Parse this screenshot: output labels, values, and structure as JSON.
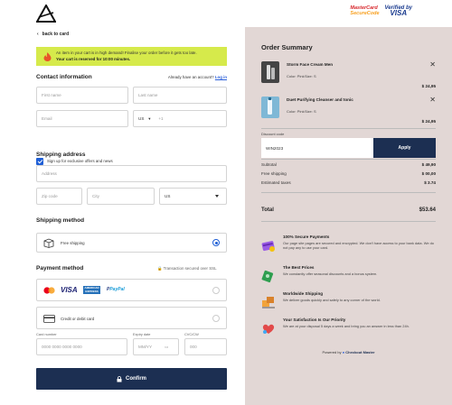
{
  "header": {
    "mastercard_line1": "MasterCard",
    "mastercard_line2": "SecureCode",
    "visa_line1": "Verified by",
    "visa_line2": "VISA"
  },
  "nav": {
    "back_label": "back to card"
  },
  "alert": {
    "line1": "An item in your cart is in high demand! Finalise your order before it gets too late.",
    "line2": "Your cart is reserved for 10:00 minutes."
  },
  "contact": {
    "title": "Contact information",
    "account_prompt": "Already have an account?",
    "login_label": "Log in",
    "first_name_placeholder": "First name",
    "last_name_placeholder": "Last name",
    "email_placeholder": "Email",
    "country_code": "US",
    "phone_prefix": "+1",
    "signup_label": "Sign up for exclusive offers and news"
  },
  "shipping": {
    "title": "Shipping address",
    "address_placeholder": "Address",
    "zip_placeholder": "Zip code",
    "city_placeholder": "City",
    "country_value": "US"
  },
  "shipping_method": {
    "title": "Shipping method",
    "option_label": "Free shipping"
  },
  "payment": {
    "title": "Payment method",
    "secured_label": "Transaction secured over SSL",
    "card_option_label": "Credit or debit card",
    "card_number_label": "Card number",
    "card_number_placeholder": "0000  0000  0000  0000",
    "expiry_label": "Expiry date",
    "expiry_placeholder": "MM/YY",
    "cvc_label": "CVC/CW",
    "cvc_placeholder": "000",
    "confirm_label": "Confirm"
  },
  "summary": {
    "title": "Order Summary",
    "items": [
      {
        "name": "Storm Face Cream Men",
        "color_label": "Color: Pink",
        "size_label": "Size: S",
        "price": "$ 24,95"
      },
      {
        "name": "Duet Purifying Cleanser and tonic",
        "color_label": "Color: Pink",
        "size_label": "Size: S",
        "price": "$ 24,95"
      }
    ],
    "discount_label": "Discount code",
    "discount_value": "WIN2023",
    "apply_label": "Apply",
    "subtotal_label": "Subtotal",
    "subtotal_value": "$ 49,90",
    "shipping_label": "Free shipping",
    "shipping_value": "$ 00,00",
    "taxes_label": "Estimated taxes",
    "taxes_value": "$ 3.74",
    "total_label": "Total",
    "total_value": "$53.64"
  },
  "features": [
    {
      "title": "100% Secure Payments",
      "desc": "Our page site pages are secured and encrypted. We don't have access to your bank data. We do not pay any to use your card."
    },
    {
      "title": "The Best Prices",
      "desc": "We constantly offer seasonal discounts and a bonus system."
    },
    {
      "title": "Worldwide Shipping",
      "desc": "We deliver goods quickly and safely to any corner of the world."
    },
    {
      "title": "Your Satisfaction Is Our Priority",
      "desc": "We are at your disposal 5 days a week and bring you an answer in less than 24h."
    }
  ],
  "footer": {
    "powered_label": "Powered by",
    "brand": "Checkout Master"
  },
  "colors": {
    "accent": "#1c2f52",
    "alert_bg": "#d6ea4b",
    "summary_bg": "#e2d7d5",
    "link": "#2b5fd9"
  }
}
